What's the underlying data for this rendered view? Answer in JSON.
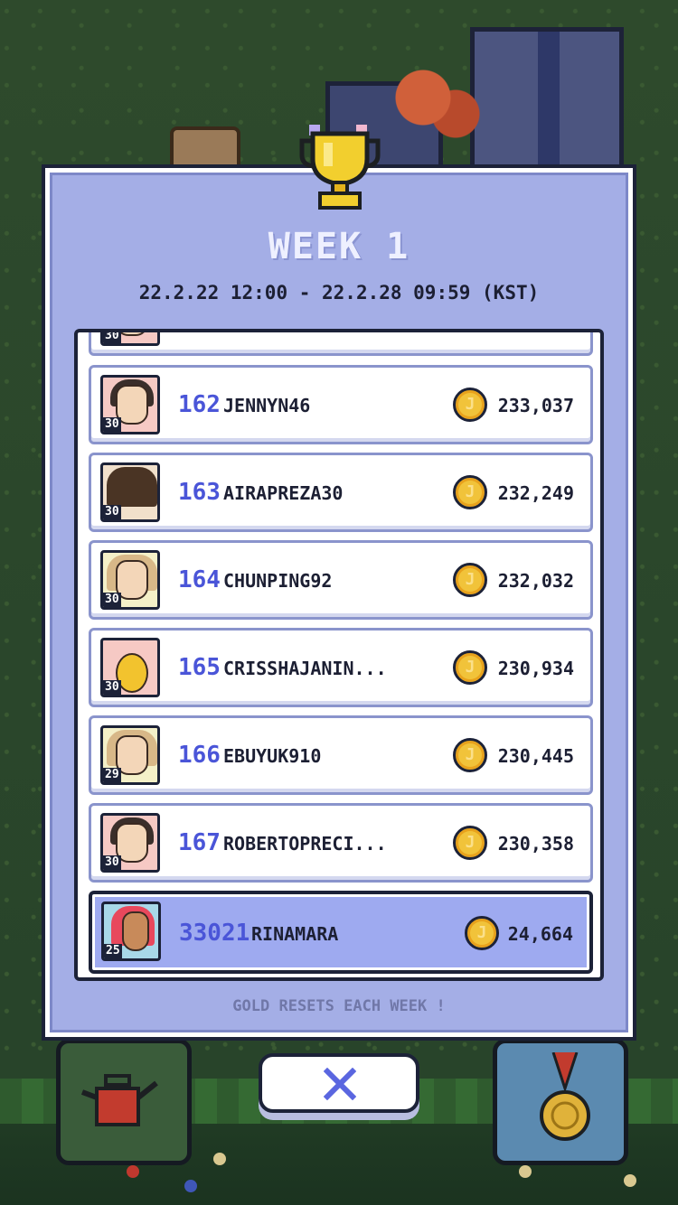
{
  "modal": {
    "title": "WEEK 1",
    "date_range": "22.2.22 12:00 - 22.2.28 09:59 (KST)",
    "footer_note": "GOLD RESETS EACH WEEK !"
  },
  "leaderboard": {
    "rows": [
      {
        "rank": "162",
        "name": "JENNYN46",
        "gold": "233,037",
        "level": "30",
        "avatar_style": "dark-hair"
      },
      {
        "rank": "163",
        "name": "AIRAPREZA30",
        "gold": "232,249",
        "level": "30",
        "avatar_style": "hooded"
      },
      {
        "rank": "164",
        "name": "CHUNPING92",
        "gold": "232,032",
        "level": "30",
        "avatar_style": "bear-hood"
      },
      {
        "rank": "165",
        "name": "CRISSHAJANIN...",
        "gold": "230,934",
        "level": "30",
        "avatar_style": "duck"
      },
      {
        "rank": "166",
        "name": "EBUYUK910",
        "gold": "230,445",
        "level": "29",
        "avatar_style": "bear-hood"
      },
      {
        "rank": "167",
        "name": "ROBERTOPRECI...",
        "gold": "230,358",
        "level": "30",
        "avatar_style": "dark-hair"
      }
    ],
    "partial_top_level": "30",
    "me": {
      "rank": "33021",
      "name": "RINAMARA",
      "gold": "24,664",
      "level": "25",
      "avatar_style": "pink-hair"
    }
  },
  "coin_symbol": "J",
  "icons": {
    "trophy": "trophy-icon",
    "close": "close-icon",
    "coin": "coin-icon",
    "watering_can": "watering-can-icon",
    "medal": "medal-icon"
  },
  "colors": {
    "modal_bg": "#a4aee6",
    "rank_text": "#4a55d8",
    "me_row_bg": "#9eaaf0",
    "coin": "#f1c33a"
  }
}
